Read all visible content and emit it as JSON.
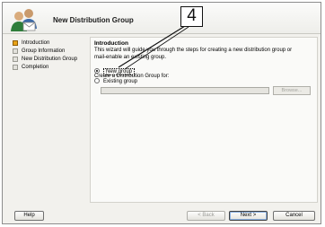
{
  "wizard": {
    "title": "New Distribution Group",
    "icon": "users-group-icon"
  },
  "steps": [
    {
      "label": "Introduction",
      "active": true
    },
    {
      "label": "Group Information",
      "active": false
    },
    {
      "label": "New Distribution Group",
      "active": false
    },
    {
      "label": "Completion",
      "active": false
    }
  ],
  "content": {
    "heading": "Introduction",
    "description": "This wizard will guide you through the steps for creating a new distribution group or mail-enable an existing group.",
    "create_label": "Create a Distribution Group for:",
    "options": [
      {
        "label": "New group",
        "checked": true
      },
      {
        "label": "Existing group",
        "checked": false
      }
    ],
    "existing_group_value": "",
    "browse_label": "Browse..."
  },
  "buttons": {
    "help": "Help",
    "back": "< Back",
    "next": "Next >",
    "cancel": "Cancel"
  },
  "callout": {
    "number": "4"
  },
  "colors": {
    "active_step": "#e8a317",
    "dialog_bg": "#f2f1ed"
  }
}
